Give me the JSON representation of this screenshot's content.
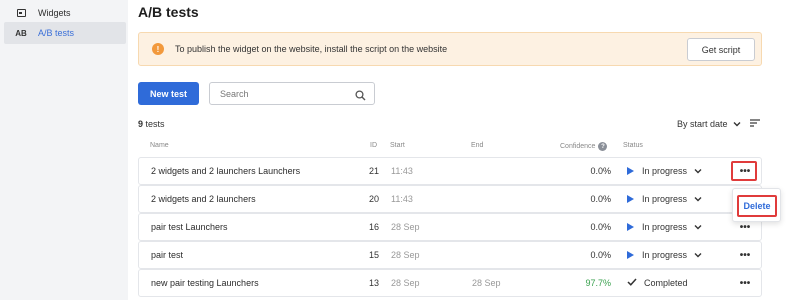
{
  "sidebar": {
    "items": [
      {
        "icon": "widget-icon",
        "label": "Widgets",
        "active": false
      },
      {
        "icon": "ab-icon",
        "icon_text": "AB",
        "label": "A/B tests",
        "active": true
      }
    ]
  },
  "page": {
    "title": "A/B tests"
  },
  "alert": {
    "icon": "info-icon",
    "icon_text": "!",
    "text": "To publish the widget on the website, install the script on the website",
    "button": "Get script"
  },
  "toolbar": {
    "new_button": "New test",
    "search_placeholder": "Search",
    "count_number": "9",
    "count_label": "tests",
    "sort_label": "By start date"
  },
  "table": {
    "headers": {
      "name": "Name",
      "id": "ID",
      "start": "Start",
      "end": "End",
      "confidence": "Confidence",
      "confidence_help": "?",
      "status": "Status"
    },
    "rows": [
      {
        "name": "2 widgets and 2 launchers Launchers",
        "id": "21",
        "start": "11:43",
        "end": "",
        "confidence": "0.0%",
        "status": "In progress",
        "state": "progress"
      },
      {
        "name": "2 widgets and 2 launchers",
        "id": "20",
        "start": "11:43",
        "end": "",
        "confidence": "0.0%",
        "status": "In progress",
        "state": "progress"
      },
      {
        "name": "pair test Launchers",
        "id": "16",
        "start": "28 Sep",
        "end": "",
        "confidence": "0.0%",
        "status": "In progress",
        "state": "progress"
      },
      {
        "name": "pair test",
        "id": "15",
        "start": "28 Sep",
        "end": "",
        "confidence": "0.0%",
        "status": "In progress",
        "state": "progress"
      },
      {
        "name": "new pair testing Launchers",
        "id": "13",
        "start": "28 Sep",
        "end": "28 Sep",
        "confidence": "97.7%",
        "status": "Completed",
        "state": "completed"
      }
    ],
    "more_label": "•••"
  },
  "context_menu": {
    "delete": "Delete"
  },
  "colors": {
    "accent": "#2f6bd9",
    "alert_bg": "#fdf1e2",
    "alert_icon": "#f2993c",
    "highlight": "#e03b3b",
    "success": "#3aa14f"
  }
}
